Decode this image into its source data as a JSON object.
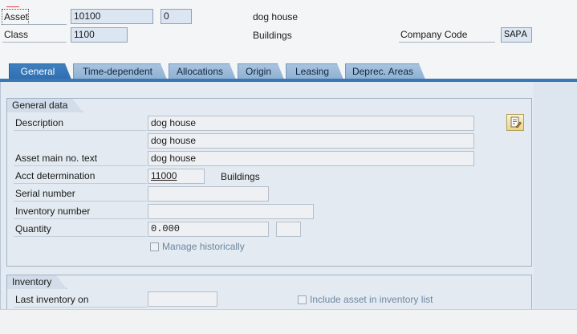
{
  "header": {
    "asset_label": "Asset",
    "asset_value": "10100",
    "subnumber_value": "0",
    "asset_description": "dog house",
    "class_label": "Class",
    "class_value": "1100",
    "class_description": "Buildings",
    "company_code_label": "Company Code",
    "company_code_value": "SAPA"
  },
  "tabs": [
    {
      "label": "General",
      "active": true
    },
    {
      "label": "Time-dependent",
      "active": false
    },
    {
      "label": "Allocations",
      "active": false
    },
    {
      "label": "Origin",
      "active": false
    },
    {
      "label": "Leasing",
      "active": false
    },
    {
      "label": "Deprec. Areas",
      "active": false
    }
  ],
  "general_data": {
    "title": "General data",
    "description_label": "Description",
    "description_1": "dog house",
    "description_2": "dog house",
    "main_text_label": "Asset main no. text",
    "main_text_value": "dog house",
    "acct_label": "Acct determination",
    "acct_value": "11000",
    "acct_text": "Buildings",
    "serial_label": "Serial number",
    "serial_value": "",
    "inventory_number_label": "Inventory number",
    "inventory_number_value": "",
    "quantity_label": "Quantity",
    "quantity_value": "0.000",
    "unit_value": "",
    "manage_historically_label": "Manage historically",
    "manage_historically_checked": false
  },
  "inventory": {
    "title": "Inventory",
    "last_inventory_label": "Last inventory on",
    "last_inventory_value": "",
    "include_label": "Include asset in inventory list",
    "include_checked": false
  },
  "icons": {
    "long_text": "long-text-edit-icon"
  },
  "colors": {
    "active_tab": "#2f6eb0",
    "inactive_tab": "#9bbad9",
    "field_blue": "#dbe6f2"
  }
}
